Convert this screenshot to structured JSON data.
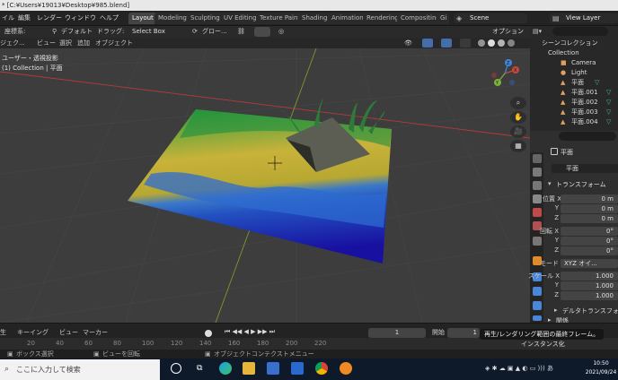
{
  "title_bar": {
    "text": "* [C:¥Users¥19013¥Desktop¥985.blend]"
  },
  "menu": {
    "items": [
      "イル",
      "編集",
      "レンダー",
      "ウィンドウ",
      "ヘルプ"
    ],
    "workspaces": [
      "Layout",
      "Modeling",
      "Sculpting",
      "UV Editing",
      "Texture Paint",
      "Shading",
      "Animation",
      "Rendering",
      "Compositing",
      "Gi"
    ],
    "scene": "Scene",
    "view_layer": "View Layer"
  },
  "tool_header": {
    "orientation_label": "座標系:",
    "orientation_value": "デフォルト",
    "drag_label": "ドラッグ:",
    "drag_value": "Select Box",
    "transform_value": "グロー...",
    "options": "オプション"
  },
  "viewport_header": {
    "items": [
      "ジェク...",
      "ビュー",
      "選択",
      "追加",
      "オブジェクト"
    ]
  },
  "viewport": {
    "view_name": "ユーザー・透視投影",
    "collection_info": "(1) Collection | 平面",
    "gizmo": {
      "x": "X",
      "y": "Y",
      "z": "Z"
    }
  },
  "outliner": {
    "title": "シーンコレクション",
    "collection": "Collection",
    "items": [
      "Camera",
      "Light",
      "平面",
      "平面.001",
      "平面.002",
      "平面.003",
      "平面.004"
    ]
  },
  "properties": {
    "object_name": "平面",
    "object_field": "平面",
    "transform_header": "トランスフォーム",
    "location_label": "位置 X",
    "location": [
      "0 m",
      "0 m",
      "0 m"
    ],
    "rotation_label": "回転 X",
    "rotation": [
      "0°",
      "0°",
      "0°"
    ],
    "mode_label": "モード",
    "mode_value": "XYZ オイ...",
    "scale_label": "スケール X",
    "scale": [
      "1.000",
      "1.000",
      "1.000"
    ],
    "axis_y": "Y",
    "axis_z": "Z",
    "delta_transform": "デルタトランスフォー",
    "relations": "関係",
    "instancing": "インスタンス化"
  },
  "timeline": {
    "playback": "生",
    "keying": "キーイング",
    "view": "ビュー",
    "marker": "マーカー",
    "current_frame": "1",
    "start_label": "開始",
    "start_value": "1",
    "ruler_ticks": [
      "20",
      "40",
      "60",
      "80",
      "100",
      "120",
      "140",
      "160",
      "180",
      "200",
      "220"
    ]
  },
  "tooltip": {
    "text": "再生/レンダリング範囲の最終フレーム。"
  },
  "status_bar": {
    "left": "ボックス選択",
    "middle": "ビューを回転",
    "right": "オブジェクトコンテクストメニュー"
  },
  "taskbar": {
    "search_placeholder": "ここに入力して検索",
    "time": "10:50",
    "date": "2021/09/24"
  },
  "colors": {
    "accent": "#4772b3",
    "viewport_bg": "#3d3d3d",
    "grid_line": "#474747",
    "axis_x": "#b83a3a",
    "axis_y": "#7a9a2a"
  }
}
